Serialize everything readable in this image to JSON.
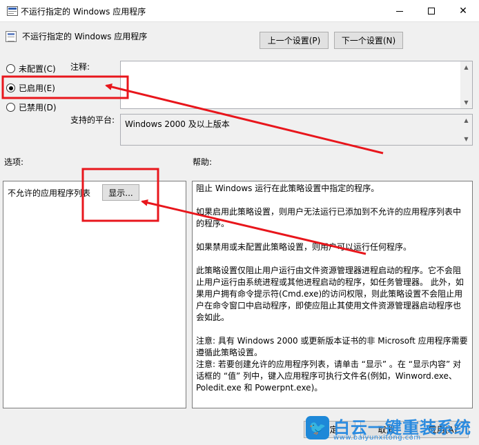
{
  "window": {
    "title": "不运行指定的 Windows 应用程序"
  },
  "header": {
    "title": "不运行指定的 Windows 应用程序",
    "prev_label": "上一个设置(P)",
    "next_label": "下一个设置(N)"
  },
  "state": {
    "options": [
      {
        "label": "未配置(C)",
        "selected": false
      },
      {
        "label": "已启用(E)",
        "selected": true
      },
      {
        "label": "已禁用(D)",
        "selected": false
      }
    ]
  },
  "comment": {
    "label": "注释:",
    "value": ""
  },
  "platform": {
    "label": "支持的平台:",
    "value": "Windows 2000 及以上版本"
  },
  "options_section": {
    "label": "选项:",
    "list_label": "不允许的应用程序列表",
    "show_label": "显示..."
  },
  "help_section": {
    "label": "帮助:",
    "paragraphs": [
      "阻止 Windows 运行在此策略设置中指定的程序。",
      "如果启用此策略设置，则用户无法运行已添加到不允许的应用程序列表中的程序。",
      "如果禁用或未配置此策略设置，则用户可以运行任何程序。",
      "此策略设置仅阻止用户运行由文件资源管理器进程启动的程序。它不会阻止用户运行由系统进程或其他进程启动的程序，如任务管理器。 此外，如果用户拥有命令提示符(Cmd.exe)的访问权限，则此策略设置不会阻止用户在命令窗口中启动程序，即使应阻止其使用文件资源管理器启动程序也会如此。",
      "注意: 具有 Windows 2000 或更新版本证书的非 Microsoft 应用程序需要遵循此策略设置。",
      "注意: 若要创建允许的应用程序列表，请单击 “显示” 。在 “显示内容” 对话框的 “值” 列中，键入应用程序可执行文件名(例如，Winword.exe、Poledit.exe 和 Powerpnt.exe)。"
    ]
  },
  "footer": {
    "ok_label": "确定",
    "cancel_label": "取消",
    "apply_label": "应用(A)"
  },
  "watermark": {
    "title": "白云一键重装系统",
    "url": "www.baiyunxitong.com"
  },
  "icons": [
    "policy-icon",
    "minimize-icon",
    "maximize-icon",
    "close-icon",
    "scroll-up-icon",
    "scroll-down-icon",
    "twitter-bird-icon"
  ],
  "colors": {
    "annotation": "#e8161c",
    "watermark": "#2a8be0"
  }
}
